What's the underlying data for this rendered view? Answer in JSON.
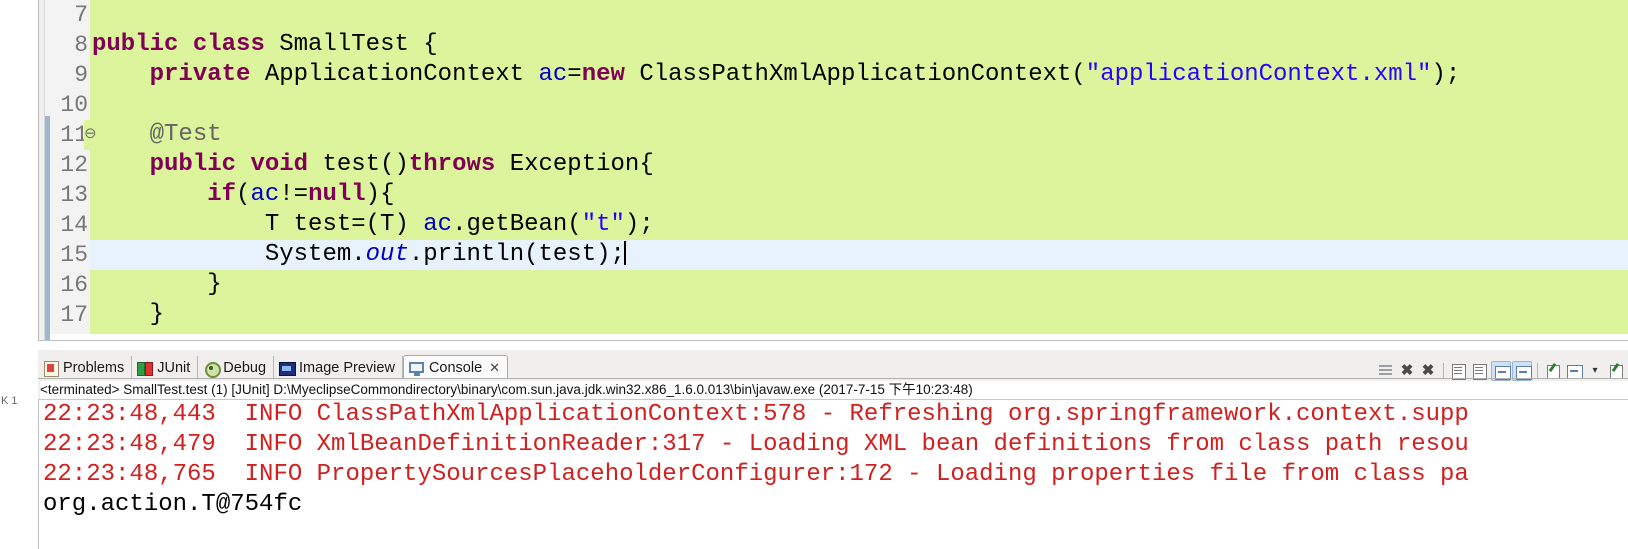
{
  "editor": {
    "name": "java-editor",
    "background_color": "#dcf59c",
    "highlight_line_color": "#e8f2fc",
    "lines": [
      {
        "num": "7",
        "fold": "",
        "highlight": false,
        "tokens": []
      },
      {
        "num": "8",
        "fold": "",
        "highlight": false,
        "tokens": [
          {
            "t": "public",
            "c": "kw"
          },
          {
            "t": " ",
            "c": "plain"
          },
          {
            "t": "class",
            "c": "kw"
          },
          {
            "t": " SmallTest {",
            "c": "plain"
          }
        ]
      },
      {
        "num": "9",
        "fold": "",
        "highlight": false,
        "tokens": [
          {
            "t": "    ",
            "c": "plain"
          },
          {
            "t": "private",
            "c": "kw"
          },
          {
            "t": " ApplicationContext ",
            "c": "plain"
          },
          {
            "t": "ac",
            "c": "field"
          },
          {
            "t": "=",
            "c": "plain"
          },
          {
            "t": "new",
            "c": "kw"
          },
          {
            "t": " ClassPathXmlApplicationContext(",
            "c": "plain"
          },
          {
            "t": "\"applicationContext.xml\"",
            "c": "str"
          },
          {
            "t": ");",
            "c": "plain"
          }
        ]
      },
      {
        "num": "10",
        "fold": "",
        "highlight": false,
        "tokens": []
      },
      {
        "num": "11",
        "fold": "⊖",
        "highlight": false,
        "tokens": [
          {
            "t": "    ",
            "c": "plain"
          },
          {
            "t": "@Test",
            "c": "annot"
          }
        ]
      },
      {
        "num": "12",
        "fold": "",
        "highlight": false,
        "tokens": [
          {
            "t": "    ",
            "c": "plain"
          },
          {
            "t": "public",
            "c": "kw"
          },
          {
            "t": " ",
            "c": "plain"
          },
          {
            "t": "void",
            "c": "kw"
          },
          {
            "t": " test()",
            "c": "plain"
          },
          {
            "t": "throws",
            "c": "kw"
          },
          {
            "t": " Exception{",
            "c": "plain"
          }
        ]
      },
      {
        "num": "13",
        "fold": "",
        "highlight": false,
        "tokens": [
          {
            "t": "        ",
            "c": "plain"
          },
          {
            "t": "if",
            "c": "kw"
          },
          {
            "t": "(",
            "c": "plain"
          },
          {
            "t": "ac",
            "c": "field"
          },
          {
            "t": "!=",
            "c": "plain"
          },
          {
            "t": "null",
            "c": "kw"
          },
          {
            "t": "){",
            "c": "plain"
          }
        ]
      },
      {
        "num": "14",
        "fold": "",
        "highlight": false,
        "tokens": [
          {
            "t": "            T test=(T) ",
            "c": "plain"
          },
          {
            "t": "ac",
            "c": "field"
          },
          {
            "t": ".getBean(",
            "c": "plain"
          },
          {
            "t": "\"t\"",
            "c": "str"
          },
          {
            "t": ");",
            "c": "plain"
          }
        ]
      },
      {
        "num": "15",
        "fold": "",
        "highlight": true,
        "tokens": [
          {
            "t": "            System.",
            "c": "plain"
          },
          {
            "t": "out",
            "c": "stat"
          },
          {
            "t": ".println(test);",
            "c": "plain"
          }
        ],
        "caret": true
      },
      {
        "num": "16",
        "fold": "",
        "highlight": false,
        "tokens": [
          {
            "t": "        }",
            "c": "plain"
          }
        ]
      },
      {
        "num": "17",
        "fold": "",
        "highlight": false,
        "tokens": [
          {
            "t": "    }",
            "c": "plain"
          }
        ]
      }
    ]
  },
  "left_margin": {
    "label": "K 1"
  },
  "panel": {
    "tabs": [
      {
        "label": "Problems",
        "icon": "problems-icon",
        "active": false,
        "closable": false
      },
      {
        "label": "JUnit",
        "icon": "junit-icon",
        "active": false,
        "closable": false
      },
      {
        "label": "Debug",
        "icon": "debug-icon",
        "active": false,
        "closable": false
      },
      {
        "label": "Image Preview",
        "icon": "image-preview-icon",
        "active": false,
        "closable": false
      },
      {
        "label": "Console",
        "icon": "console-icon",
        "active": true,
        "closable": true,
        "close_glyph": "✕"
      }
    ],
    "toolbar": [
      {
        "name": "terminate-all-icon",
        "glyph": ""
      },
      {
        "name": "remove-launch-icon",
        "glyph": "✖"
      },
      {
        "name": "remove-all-launches-icon",
        "glyph": "✖"
      },
      {
        "name": "separator-1",
        "glyph": ""
      },
      {
        "name": "show-console-icon",
        "glyph": ""
      },
      {
        "name": "pin-console-icon",
        "glyph": ""
      },
      {
        "name": "display-selected-console-icon",
        "glyph": ""
      },
      {
        "name": "close-console-icon",
        "glyph": ""
      },
      {
        "name": "separator-2",
        "glyph": ""
      },
      {
        "name": "open-console-icon",
        "glyph": ""
      },
      {
        "name": "scroll-lock-icon",
        "glyph": ""
      },
      {
        "name": "console-dropdown-icon",
        "glyph": "▾"
      },
      {
        "name": "new-console-view-icon",
        "glyph": ""
      }
    ],
    "process_line": "<terminated> SmallTest.test (1) [JUnit] D:\\MyeclipseCommondirectory\\binary\\com.sun.java.jdk.win32.x86_1.6.0.013\\bin\\javaw.exe (2017-7-15 下午10:23:48)",
    "console_lines": [
      {
        "text": "22:23:48,443  INFO ClassPathXmlApplicationContext:578 - Refreshing org.springframework.context.supp",
        "stream": "err"
      },
      {
        "text": "22:23:48,479  INFO XmlBeanDefinitionReader:317 - Loading XML bean definitions from class path resou",
        "stream": "err"
      },
      {
        "text": "22:23:48,765  INFO PropertySourcesPlaceholderConfigurer:172 - Loading properties file from class pa",
        "stream": "err"
      },
      {
        "text": "org.action.T@754fc",
        "stream": "out"
      }
    ],
    "colors": {
      "error_text": "#d02020",
      "stdout_text": "#000000",
      "console_bg": "#ffffff",
      "panel_bg": "#f0efee"
    }
  }
}
